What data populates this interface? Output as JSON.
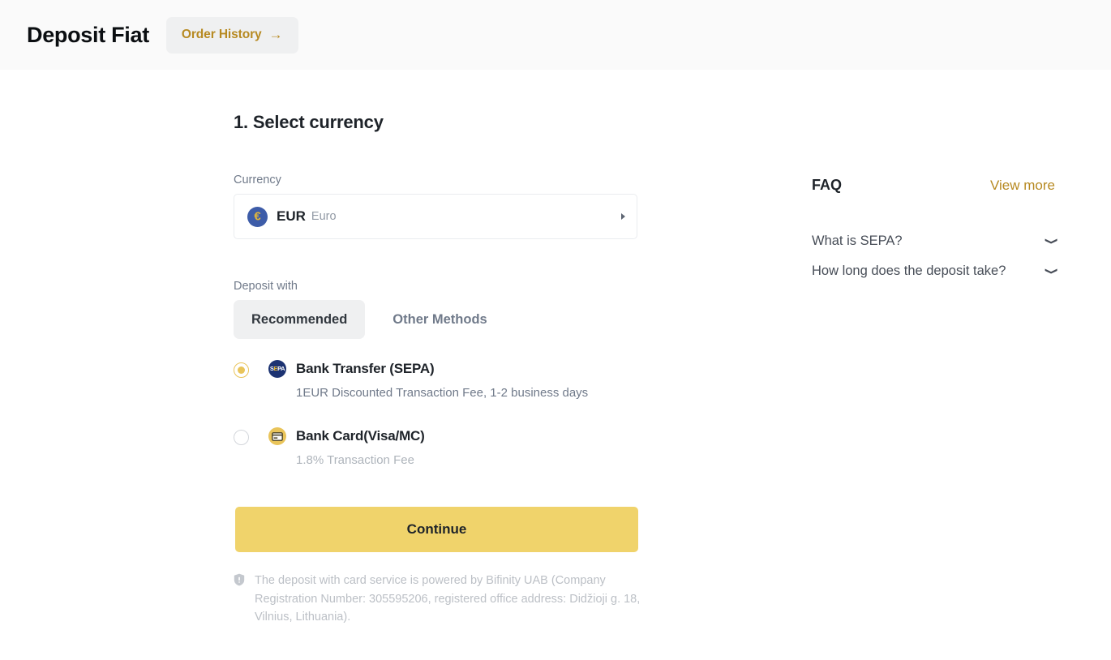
{
  "header": {
    "title": "Deposit Fiat",
    "order_history_label": "Order History",
    "arrow_icon": "arrow-right-icon",
    "accent_gold": "#b78a22",
    "bar_bg": "#fafafa"
  },
  "main": {
    "step_title": "1. Select currency",
    "currency_label": "Currency",
    "currency": {
      "code": "EUR",
      "name": "Euro",
      "icon": "eur-coin-icon",
      "icon_bg": "#3d5ca8",
      "icon_fg": "#e3b73a"
    },
    "deposit_with_label": "Deposit with",
    "tabs": [
      {
        "label": "Recommended",
        "active": true
      },
      {
        "label": "Other Methods",
        "active": false
      }
    ],
    "methods": [
      {
        "name": "Bank Transfer (SEPA)",
        "description": "1EUR Discounted Transaction Fee, 1-2 business days",
        "selected": true,
        "icon": "sepa-icon"
      },
      {
        "name": "Bank Card(Visa/MC)",
        "description": "1.8% Transaction Fee",
        "selected": false,
        "icon": "bank-card-icon"
      }
    ],
    "continue_label": "Continue",
    "continue_color": "#f0d36b",
    "footer_icon": "shield-icon",
    "footer_note": "The deposit with card service is powered by Bifinity UAB (Company Registration Number: 305595206, registered office address: Didžioji g. 18, Vilnius, Lithuania)."
  },
  "faq": {
    "title": "FAQ",
    "view_more": "View more",
    "items": [
      {
        "question": "What is SEPA?",
        "icon": "chevron-down-icon"
      },
      {
        "question": "How long does the deposit take?",
        "icon": "chevron-down-icon"
      }
    ]
  }
}
